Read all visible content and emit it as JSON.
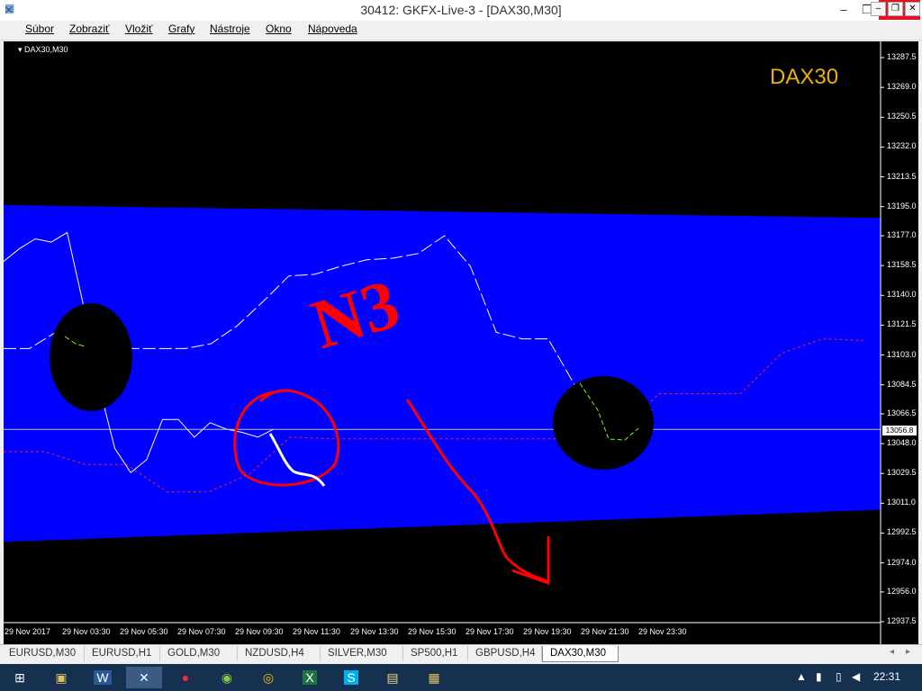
{
  "window": {
    "title": "30412: GKFX-Live-3 - [DAX30,M30]",
    "minimize_glyph": "–",
    "maximize_glyph": "❐",
    "close_glyph": "✕"
  },
  "menu": {
    "items": [
      "Súbor",
      "Zobraziť",
      "Vložiť",
      "Grafy",
      "Nástroje",
      "Okno",
      "Nápoveda"
    ]
  },
  "chart": {
    "symbol_label": "DAX30,M30",
    "watermark": "DAX30",
    "annotation_text": "N3",
    "current_price": "13056.8",
    "colors": {
      "background": "#000000",
      "channel_fill": "#0000ff",
      "annotation": "#ff0000",
      "watermark": "#e8b400",
      "marker_fill": "#000000"
    }
  },
  "chart_data": {
    "type": "line",
    "title": "DAX30,M30",
    "ylim": [
      12937.5,
      13287.5
    ],
    "y_ticks": [
      "13287.5",
      "13269.0",
      "13250.5",
      "13232.0",
      "13213.5",
      "13195.0",
      "13177.0",
      "13158.5",
      "13140.0",
      "13121.5",
      "13103.0",
      "13084.5",
      "13066.5",
      "13048.0",
      "13029.5",
      "13011.0",
      "12992.5",
      "12974.0",
      "12956.0",
      "12937.5"
    ],
    "x_ticks": [
      "29 Nov 2017",
      "29 Nov 03:30",
      "29 Nov 05:30",
      "29 Nov 07:30",
      "29 Nov 09:30",
      "29 Nov 11:30",
      "29 Nov 13:30",
      "29 Nov 15:30",
      "29 Nov 17:30",
      "29 Nov 19:30",
      "29 Nov 21:30",
      "29 Nov 23:30"
    ],
    "current_price": 13056.8,
    "channel": {
      "upper": [
        13196.0,
        13188.0
      ],
      "lower": [
        12987.0,
        13007.0
      ]
    },
    "series": [
      {
        "values": [
          13161,
          13169,
          13175,
          13173,
          13179,
          13135,
          13084,
          13045,
          13030,
          13038,
          13063,
          13063,
          13052,
          13061,
          13057,
          13055,
          13052,
          13057
        ]
      },
      {
        "values": [
          13107,
          13107,
          13117,
          13115,
          13110,
          13107,
          13107,
          13107,
          13110,
          13121,
          13136,
          13152,
          13153,
          13158,
          13162,
          13163,
          13166,
          13177,
          13158,
          13117,
          13113,
          13113,
          13085,
          13053,
          13054,
          13069
        ]
      },
      {
        "values": [
          13043,
          13043,
          13035,
          13035,
          13018,
          13018,
          13029,
          13052,
          13051,
          13051,
          13051,
          13051,
          13051,
          13051,
          13051,
          13052,
          13079,
          13079,
          13079,
          13104,
          13113,
          13112
        ]
      }
    ]
  },
  "tabs": [
    "EURUSD,M30",
    "EURUSD,H1",
    "GOLD,M30",
    "NZDUSD,H4",
    "SILVER,M30",
    "SP500,H1",
    "GBPUSD,H4",
    "DAX30,M30"
  ],
  "active_tab": "DAX30,M30",
  "taskbar": {
    "clock": "22:31",
    "apps": [
      "start-icon",
      "file-manager-icon",
      "word-icon",
      "metatrader-icon",
      "paint-icon",
      "globe-app-icon",
      "chrome-icon",
      "excel-icon",
      "skype-icon",
      "folder-icon",
      "image-viewer-icon"
    ]
  }
}
